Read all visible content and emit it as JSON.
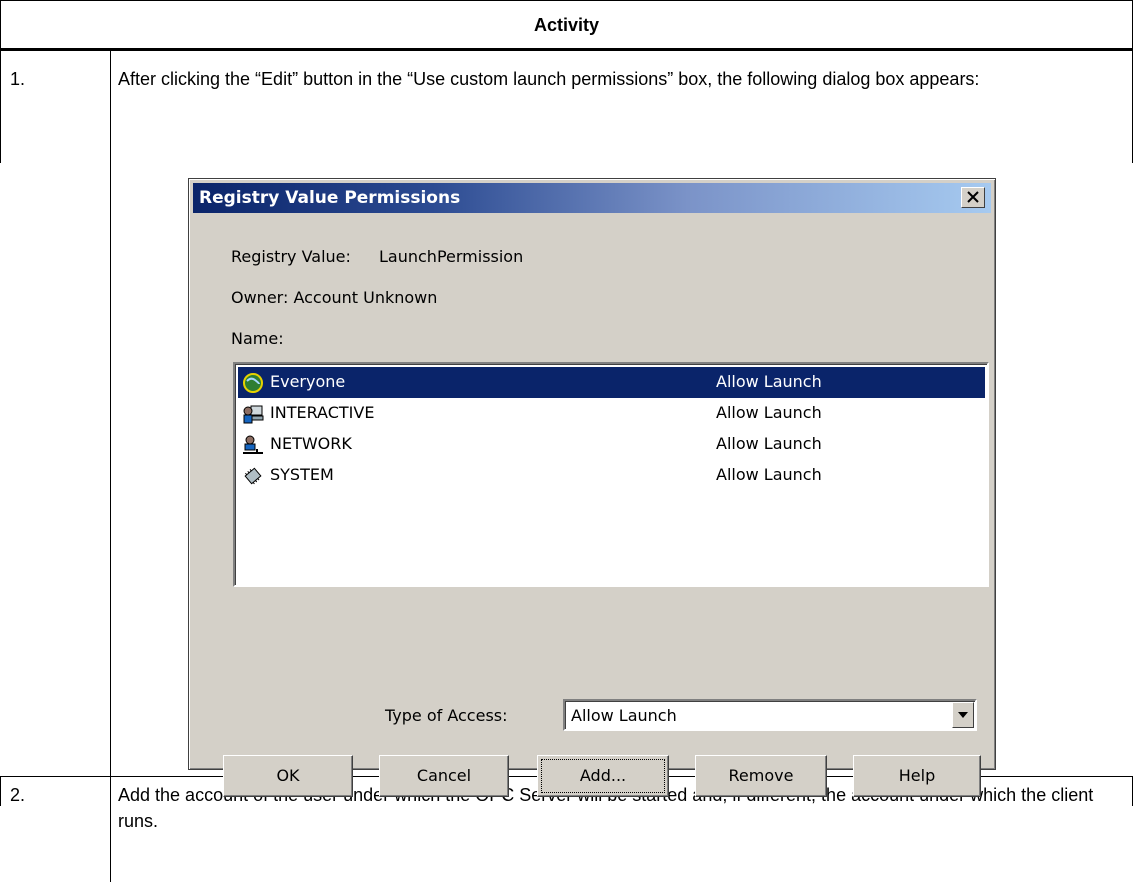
{
  "table": {
    "header": "Activity",
    "rows": [
      {
        "number": "1.",
        "text": "After clicking the “Edit” button in the “Use custom launch permissions” box, the following dialog box appears:"
      },
      {
        "number": "2.",
        "text": "Add the account of the user under which the OPC Server will be started and, if different, the account under which the client runs."
      }
    ]
  },
  "dialog": {
    "title": "Registry Value Permissions",
    "close_label": "x",
    "registry_value_label": "Registry Value:",
    "registry_value": "LaunchPermission",
    "owner_line": "Owner: Account Unknown",
    "name_label": "Name:",
    "accounts": [
      {
        "name": "Everyone",
        "permission": "Allow Launch",
        "icon": "globe-icon",
        "selected": true
      },
      {
        "name": "INTERACTIVE",
        "permission": "Allow Launch",
        "icon": "interactive-user-icon",
        "selected": false
      },
      {
        "name": "NETWORK",
        "permission": "Allow Launch",
        "icon": "network-user-icon",
        "selected": false
      },
      {
        "name": "SYSTEM",
        "permission": "Allow Launch",
        "icon": "system-chip-icon",
        "selected": false
      }
    ],
    "type_of_access_label": "Type of Access:",
    "type_of_access_value": "Allow Launch",
    "buttons": {
      "ok": "OK",
      "cancel": "Cancel",
      "add": "Add...",
      "remove": "Remove",
      "help": "Help"
    }
  },
  "colors": {
    "selection": "#0a246a",
    "dialog_face": "#d4d0c8"
  }
}
